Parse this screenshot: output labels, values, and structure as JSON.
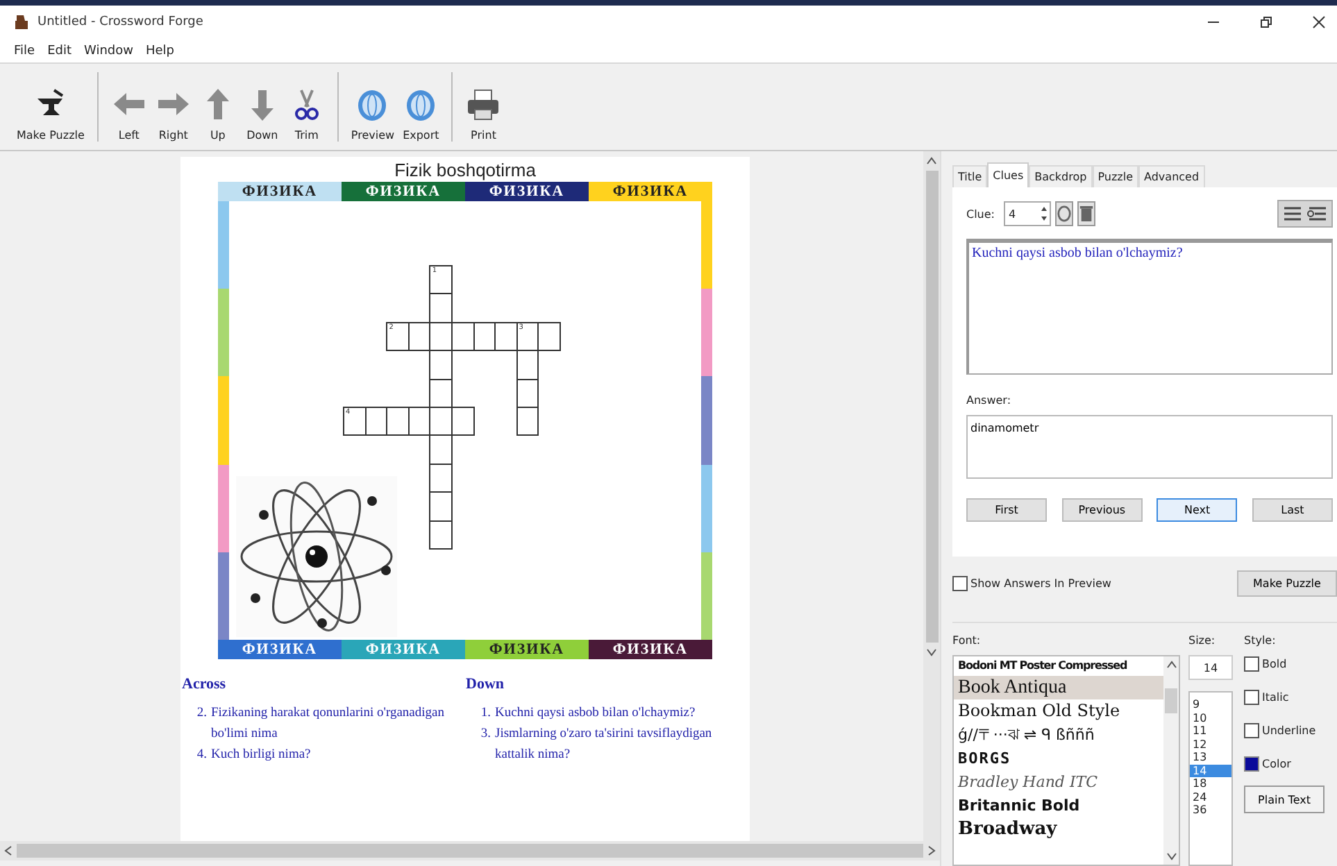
{
  "window": {
    "title": "Untitled - Crossword Forge"
  },
  "menu": [
    "File",
    "Edit",
    "Window",
    "Help"
  ],
  "toolbar": [
    {
      "label": "Make Puzzle",
      "kind": "anvil",
      "group_end": true
    },
    {
      "label": "Left",
      "kind": "left"
    },
    {
      "label": "Right",
      "kind": "right"
    },
    {
      "label": "Up",
      "kind": "up"
    },
    {
      "label": "Down",
      "kind": "down"
    },
    {
      "label": "Trim",
      "kind": "scissors",
      "group_end": true
    },
    {
      "label": "Preview",
      "kind": "globe"
    },
    {
      "label": "Export",
      "kind": "globe",
      "group_end": true
    },
    {
      "label": "Print",
      "kind": "printer"
    }
  ],
  "puzzle": {
    "title": "Fizik boshqotirma",
    "top_tiles": [
      {
        "text": "ФИЗИКА",
        "color": "#bfe0f2"
      },
      {
        "text": "ФИЗИКА",
        "color": "#16703a"
      },
      {
        "text": "ФИЗИКА",
        "color": "#1e2a78"
      },
      {
        "text": "ФИЗИКА",
        "color": "#ffd21e"
      }
    ],
    "bottom_tiles": [
      {
        "text": "ФИЗИКА",
        "color": "#2f6fcf"
      },
      {
        "text": "ФИЗИКА",
        "color": "#2aa6b8"
      },
      {
        "text": "ФИЗИКА",
        "color": "#8fcf3a"
      },
      {
        "text": "ФИЗИКА",
        "color": "#4a1a38"
      }
    ],
    "left_strip": [
      {
        "color": "#8cc8ee"
      },
      {
        "color": "#a8d870"
      },
      {
        "color": "#ffd21e"
      },
      {
        "color": "#f29ac4"
      },
      {
        "color": "#7a86c6"
      }
    ],
    "right_strip": [
      {
        "color": "#ffd21e"
      },
      {
        "color": "#f29ac4"
      },
      {
        "color": "#7a86c6"
      },
      {
        "color": "#8cc8ee"
      },
      {
        "color": "#a8d870"
      }
    ],
    "grid": [
      [
        {
          "kind": "empty"
        },
        {
          "kind": "empty"
        },
        {
          "kind": "empty"
        },
        {
          "kind": "empty"
        },
        {
          "kind": "box",
          "number": "1"
        }
      ],
      [
        {
          "kind": "empty"
        },
        {
          "kind": "empty"
        },
        {
          "kind": "empty"
        },
        {
          "kind": "empty"
        },
        {
          "kind": "box"
        }
      ],
      [
        {
          "kind": "empty"
        },
        {
          "kind": "empty"
        },
        {
          "kind": "box",
          "number": "2"
        },
        {
          "kind": "box"
        },
        {
          "kind": "box"
        },
        {
          "kind": "box"
        },
        {
          "kind": "box"
        },
        {
          "kind": "box"
        },
        {
          "kind": "box",
          "number": "3"
        },
        {
          "kind": "box"
        }
      ],
      [
        {
          "kind": "empty"
        },
        {
          "kind": "empty"
        },
        {
          "kind": "empty"
        },
        {
          "kind": "empty"
        },
        {
          "kind": "box"
        },
        {
          "kind": "empty"
        },
        {
          "kind": "empty"
        },
        {
          "kind": "empty"
        },
        {
          "kind": "box"
        }
      ],
      [
        {
          "kind": "empty"
        },
        {
          "kind": "empty"
        },
        {
          "kind": "empty"
        },
        {
          "kind": "empty"
        },
        {
          "kind": "box"
        },
        {
          "kind": "empty"
        },
        {
          "kind": "empty"
        },
        {
          "kind": "empty"
        },
        {
          "kind": "box"
        }
      ],
      [
        {
          "kind": "box",
          "number": "4"
        },
        {
          "kind": "box"
        },
        {
          "kind": "box"
        },
        {
          "kind": "box"
        },
        {
          "kind": "box"
        },
        {
          "kind": "box"
        },
        {
          "kind": "empty"
        },
        {
          "kind": "empty"
        },
        {
          "kind": "box"
        }
      ],
      [
        {
          "kind": "empty"
        },
        {
          "kind": "empty"
        },
        {
          "kind": "empty"
        },
        {
          "kind": "empty"
        },
        {
          "kind": "box"
        }
      ],
      [
        {
          "kind": "empty"
        },
        {
          "kind": "empty"
        },
        {
          "kind": "empty"
        },
        {
          "kind": "empty"
        },
        {
          "kind": "box"
        }
      ],
      [
        {
          "kind": "empty"
        },
        {
          "kind": "empty"
        },
        {
          "kind": "empty"
        },
        {
          "kind": "empty"
        },
        {
          "kind": "box"
        }
      ],
      [
        {
          "kind": "empty"
        },
        {
          "kind": "empty"
        },
        {
          "kind": "empty"
        },
        {
          "kind": "empty"
        },
        {
          "kind": "box"
        }
      ]
    ],
    "image": {
      "kind": "atom"
    },
    "across": {
      "heading": "Across",
      "clues": [
        {
          "number": "2.",
          "text": "Fizikaning harakat qonunlarini o'rganadigan bo'limi nima"
        },
        {
          "number": "4.",
          "text": "Kuch birligi nima?"
        }
      ]
    },
    "down": {
      "heading": "Down",
      "clues": [
        {
          "number": "1.",
          "text": "Kuchni qaysi asbob bilan o'lchaymiz?"
        },
        {
          "number": "3.",
          "text": "Jismlarning o'zaro ta'sirini tavsiflaydigan kattalik nima?"
        }
      ]
    }
  },
  "tabs": [
    {
      "label": "Title",
      "selected": false
    },
    {
      "label": "Clues",
      "selected": true
    },
    {
      "label": "Backdrop",
      "selected": false
    },
    {
      "label": "Puzzle",
      "selected": false
    },
    {
      "label": "Advanced",
      "selected": false
    }
  ],
  "clue_editor": {
    "clue_label": "Clue:",
    "clue_number": "4",
    "clue_text": "Kuchni qaysi asbob bilan o'lchaymiz?",
    "answer_label": "Answer:",
    "answer": "dinamometr",
    "nav_buttons": [
      {
        "label": "First",
        "selected": false
      },
      {
        "label": "Previous",
        "selected": false
      },
      {
        "label": "Next",
        "selected": true
      },
      {
        "label": "Last",
        "selected": false
      }
    ]
  },
  "show_answers": {
    "label": "Show Answers In Preview",
    "checked": false
  },
  "make_puzzle_button": "Make Puzzle",
  "font_panel": {
    "font_label": "Font:",
    "fonts": [
      {
        "name": "Bodoni MT Poster Compressed",
        "kind": "condensed",
        "selected": false
      },
      {
        "name": "Book Antiqua",
        "kind": "antiqua",
        "selected": true
      },
      {
        "name": "Bookman Old Style",
        "kind": "bookman",
        "selected": false
      },
      {
        "name": "ǵ//〒···ঝ ⇌ ᑫ ßñññ",
        "kind": "symbol",
        "selected": false
      },
      {
        "name": "BORGS",
        "kind": "stencil",
        "selected": false
      },
      {
        "name": "Bradley Hand ITC",
        "kind": "script",
        "selected": false
      },
      {
        "name": "Britannic Bold",
        "kind": "heavy",
        "selected": false
      },
      {
        "name": "Broadway",
        "kind": "display",
        "selected": false
      }
    ],
    "size_label": "Size:",
    "size": "14",
    "sizes": [
      {
        "value": "9",
        "selected": false
      },
      {
        "value": "10",
        "selected": false
      },
      {
        "value": "11",
        "selected": false
      },
      {
        "value": "12",
        "selected": false
      },
      {
        "value": "13",
        "selected": false
      },
      {
        "value": "14",
        "selected": true
      },
      {
        "value": "18",
        "selected": false
      },
      {
        "value": "24",
        "selected": false
      },
      {
        "value": "36",
        "selected": false
      }
    ],
    "style_label": "Style:",
    "styles": [
      {
        "label": "Bold",
        "kind": "checkbox",
        "checked": false
      },
      {
        "label": "Italic",
        "kind": "checkbox",
        "checked": false
      },
      {
        "label": "Underline",
        "kind": "checkbox",
        "checked": false
      },
      {
        "label": "Color",
        "kind": "swatch",
        "color": "#0a0a9a"
      }
    ],
    "plain_text_button": "Plain Text"
  }
}
